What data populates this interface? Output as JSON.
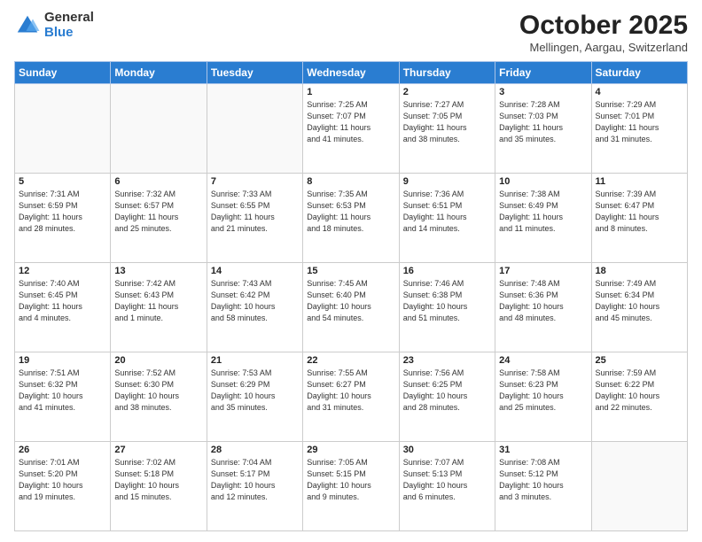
{
  "logo": {
    "general": "General",
    "blue": "Blue"
  },
  "title": {
    "month": "October 2025",
    "location": "Mellingen, Aargau, Switzerland"
  },
  "days_header": [
    "Sunday",
    "Monday",
    "Tuesday",
    "Wednesday",
    "Thursday",
    "Friday",
    "Saturday"
  ],
  "weeks": [
    [
      {
        "day": "",
        "info": ""
      },
      {
        "day": "",
        "info": ""
      },
      {
        "day": "",
        "info": ""
      },
      {
        "day": "1",
        "info": "Sunrise: 7:25 AM\nSunset: 7:07 PM\nDaylight: 11 hours\nand 41 minutes."
      },
      {
        "day": "2",
        "info": "Sunrise: 7:27 AM\nSunset: 7:05 PM\nDaylight: 11 hours\nand 38 minutes."
      },
      {
        "day": "3",
        "info": "Sunrise: 7:28 AM\nSunset: 7:03 PM\nDaylight: 11 hours\nand 35 minutes."
      },
      {
        "day": "4",
        "info": "Sunrise: 7:29 AM\nSunset: 7:01 PM\nDaylight: 11 hours\nand 31 minutes."
      }
    ],
    [
      {
        "day": "5",
        "info": "Sunrise: 7:31 AM\nSunset: 6:59 PM\nDaylight: 11 hours\nand 28 minutes."
      },
      {
        "day": "6",
        "info": "Sunrise: 7:32 AM\nSunset: 6:57 PM\nDaylight: 11 hours\nand 25 minutes."
      },
      {
        "day": "7",
        "info": "Sunrise: 7:33 AM\nSunset: 6:55 PM\nDaylight: 11 hours\nand 21 minutes."
      },
      {
        "day": "8",
        "info": "Sunrise: 7:35 AM\nSunset: 6:53 PM\nDaylight: 11 hours\nand 18 minutes."
      },
      {
        "day": "9",
        "info": "Sunrise: 7:36 AM\nSunset: 6:51 PM\nDaylight: 11 hours\nand 14 minutes."
      },
      {
        "day": "10",
        "info": "Sunrise: 7:38 AM\nSunset: 6:49 PM\nDaylight: 11 hours\nand 11 minutes."
      },
      {
        "day": "11",
        "info": "Sunrise: 7:39 AM\nSunset: 6:47 PM\nDaylight: 11 hours\nand 8 minutes."
      }
    ],
    [
      {
        "day": "12",
        "info": "Sunrise: 7:40 AM\nSunset: 6:45 PM\nDaylight: 11 hours\nand 4 minutes."
      },
      {
        "day": "13",
        "info": "Sunrise: 7:42 AM\nSunset: 6:43 PM\nDaylight: 11 hours\nand 1 minute."
      },
      {
        "day": "14",
        "info": "Sunrise: 7:43 AM\nSunset: 6:42 PM\nDaylight: 10 hours\nand 58 minutes."
      },
      {
        "day": "15",
        "info": "Sunrise: 7:45 AM\nSunset: 6:40 PM\nDaylight: 10 hours\nand 54 minutes."
      },
      {
        "day": "16",
        "info": "Sunrise: 7:46 AM\nSunset: 6:38 PM\nDaylight: 10 hours\nand 51 minutes."
      },
      {
        "day": "17",
        "info": "Sunrise: 7:48 AM\nSunset: 6:36 PM\nDaylight: 10 hours\nand 48 minutes."
      },
      {
        "day": "18",
        "info": "Sunrise: 7:49 AM\nSunset: 6:34 PM\nDaylight: 10 hours\nand 45 minutes."
      }
    ],
    [
      {
        "day": "19",
        "info": "Sunrise: 7:51 AM\nSunset: 6:32 PM\nDaylight: 10 hours\nand 41 minutes."
      },
      {
        "day": "20",
        "info": "Sunrise: 7:52 AM\nSunset: 6:30 PM\nDaylight: 10 hours\nand 38 minutes."
      },
      {
        "day": "21",
        "info": "Sunrise: 7:53 AM\nSunset: 6:29 PM\nDaylight: 10 hours\nand 35 minutes."
      },
      {
        "day": "22",
        "info": "Sunrise: 7:55 AM\nSunset: 6:27 PM\nDaylight: 10 hours\nand 31 minutes."
      },
      {
        "day": "23",
        "info": "Sunrise: 7:56 AM\nSunset: 6:25 PM\nDaylight: 10 hours\nand 28 minutes."
      },
      {
        "day": "24",
        "info": "Sunrise: 7:58 AM\nSunset: 6:23 PM\nDaylight: 10 hours\nand 25 minutes."
      },
      {
        "day": "25",
        "info": "Sunrise: 7:59 AM\nSunset: 6:22 PM\nDaylight: 10 hours\nand 22 minutes."
      }
    ],
    [
      {
        "day": "26",
        "info": "Sunrise: 7:01 AM\nSunset: 5:20 PM\nDaylight: 10 hours\nand 19 minutes."
      },
      {
        "day": "27",
        "info": "Sunrise: 7:02 AM\nSunset: 5:18 PM\nDaylight: 10 hours\nand 15 minutes."
      },
      {
        "day": "28",
        "info": "Sunrise: 7:04 AM\nSunset: 5:17 PM\nDaylight: 10 hours\nand 12 minutes."
      },
      {
        "day": "29",
        "info": "Sunrise: 7:05 AM\nSunset: 5:15 PM\nDaylight: 10 hours\nand 9 minutes."
      },
      {
        "day": "30",
        "info": "Sunrise: 7:07 AM\nSunset: 5:13 PM\nDaylight: 10 hours\nand 6 minutes."
      },
      {
        "day": "31",
        "info": "Sunrise: 7:08 AM\nSunset: 5:12 PM\nDaylight: 10 hours\nand 3 minutes."
      },
      {
        "day": "",
        "info": ""
      }
    ]
  ]
}
